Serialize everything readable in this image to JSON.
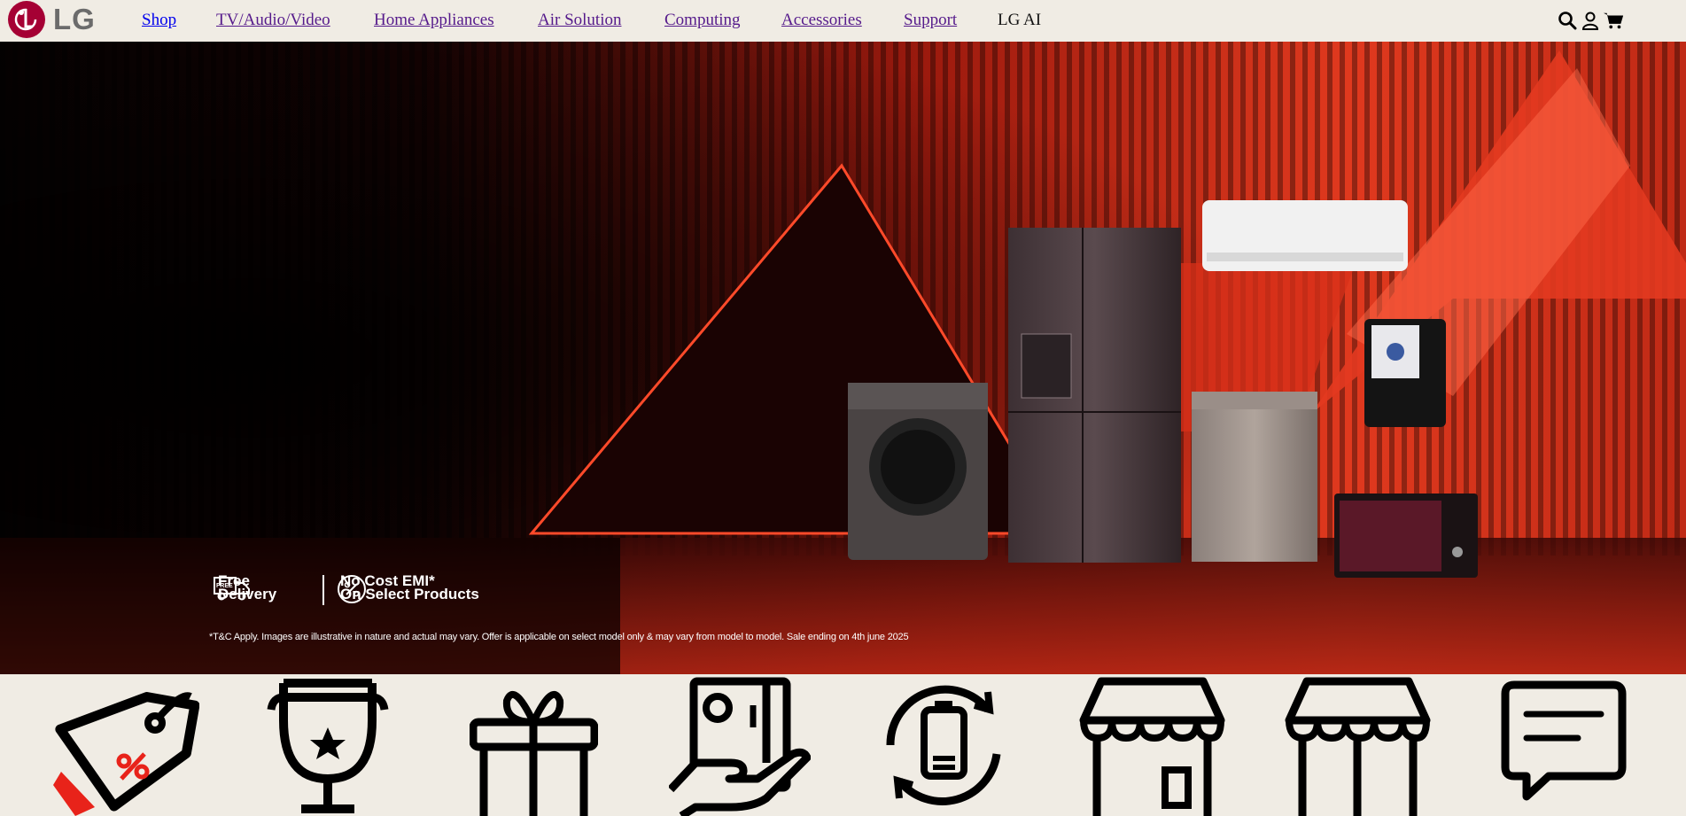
{
  "header": {
    "logo_text": "LG",
    "nav": [
      {
        "label": "Shop"
      },
      {
        "label": "TV/Audio/Video"
      },
      {
        "label": "Home Appliances"
      },
      {
        "label": "Air Solution"
      },
      {
        "label": "Computing"
      },
      {
        "label": "Accessories"
      },
      {
        "label": "Support"
      },
      {
        "label": "LG AI"
      }
    ],
    "tools": [
      "search-icon",
      "user-icon",
      "cart-icon"
    ]
  },
  "hero": {
    "badge_delivery": {
      "line1": "Free",
      "line2": "Delivery",
      "icon_text": "FREE"
    },
    "badge_emi": {
      "line1": "No Cost EMI*",
      "line2": "On Select Products"
    },
    "disclaimer": "*T&C Apply. Images are illustrative in nature and actual may vary. Offer is applicable on select model only & may vary from model to model. Sale ending on 4th june 2025",
    "colors": {
      "accent": "#e8321e",
      "dark": "#0a0202"
    }
  },
  "icon_strip": {
    "icons": [
      "price-tag-percent-icon",
      "trophy-icon",
      "gift-icon",
      "appliance-hand-icon",
      "battery-recycle-icon",
      "store-icon",
      "storefront-icon",
      "chat-icon"
    ]
  }
}
